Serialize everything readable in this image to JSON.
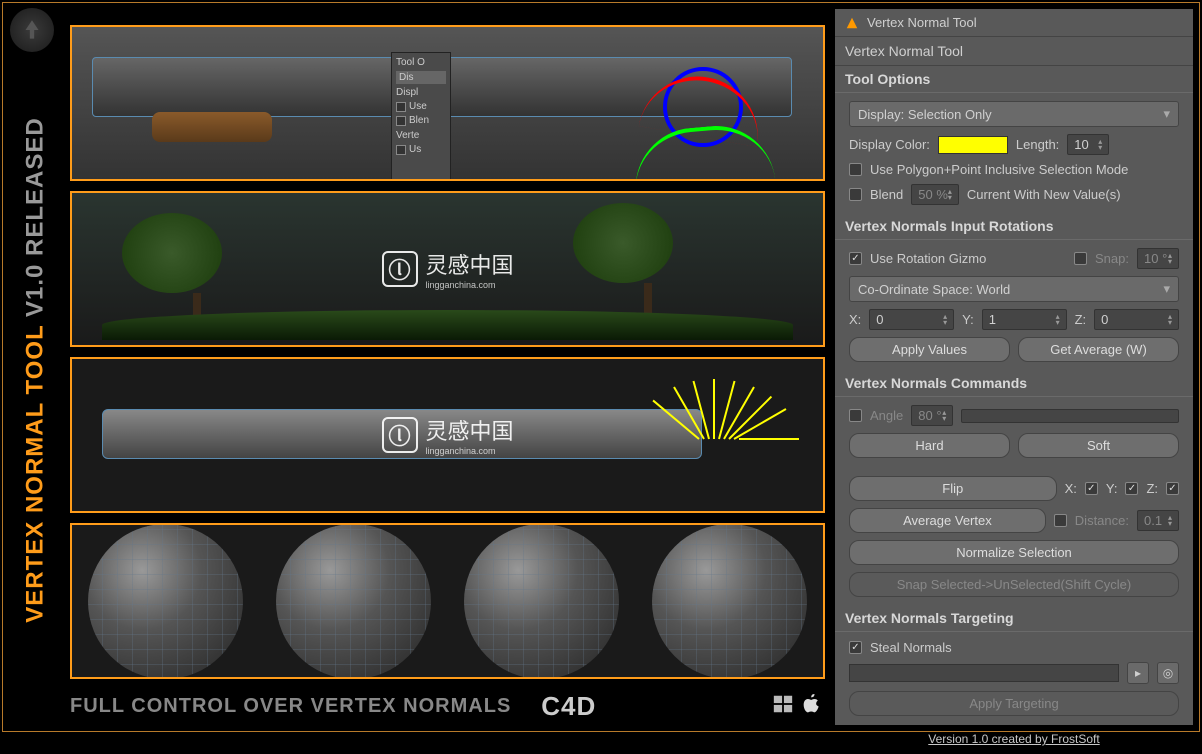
{
  "sidebar": {
    "title_a": "VERTEX NORMAL TOOL",
    "title_b": " V1.0 RELEASED"
  },
  "footer": {
    "text": "FULL CONTROL OVER VERTEX NORMALS",
    "c4d": "C4D"
  },
  "watermark": {
    "main": "灵感中国",
    "sub": "lingganchina.com"
  },
  "bgpanel": {
    "h1": "Tool O",
    "b1": "Dis",
    "r1": "Displ",
    "r2": "Use",
    "r3": "Blen",
    "h2": "Verte",
    "r4": "Us"
  },
  "panel": {
    "window_title": "Vertex Normal Tool",
    "title": "Vertex Normal Tool",
    "tool_options": {
      "header": "Tool Options",
      "display_dropdown": "Display: Selection Only",
      "display_color_label": "Display Color:",
      "length_label": "Length:",
      "length_value": "10",
      "poly_point_label": "Use Polygon+Point Inclusive Selection Mode",
      "blend_label": "Blend",
      "blend_value": "50 %",
      "blend_suffix": "Current With New Value(s)"
    },
    "input_rotations": {
      "header": "Vertex Normals Input Rotations",
      "use_gizmo_label": "Use Rotation Gizmo",
      "snap_label": "Snap:",
      "snap_value": "10 °",
      "coord_dropdown": "Co-Ordinate Space: World",
      "x_label": "X:",
      "x_value": "0",
      "y_label": "Y:",
      "y_value": "1",
      "z_label": "Z:",
      "z_value": "0",
      "apply_btn": "Apply Values",
      "avg_btn": "Get Average (W)"
    },
    "commands": {
      "header": "Vertex Normals Commands",
      "angle_label": "Angle",
      "angle_value": "80 °",
      "hard_btn": "Hard",
      "soft_btn": "Soft",
      "flip_btn": "Flip",
      "x_label": "X:",
      "y_label": "Y:",
      "z_label": "Z:",
      "avg_vertex_btn": "Average Vertex",
      "distance_label": "Distance:",
      "distance_value": "0.1",
      "normalize_btn": "Normalize Selection",
      "snap_btn": "Snap Selected->UnSelected(Shift Cycle)"
    },
    "targeting": {
      "header": "Vertex Normals Targeting",
      "steal_label": "Steal Normals",
      "apply_btn": "Apply Targeting"
    },
    "version": "Version 1.0 created by FrostSoft"
  }
}
